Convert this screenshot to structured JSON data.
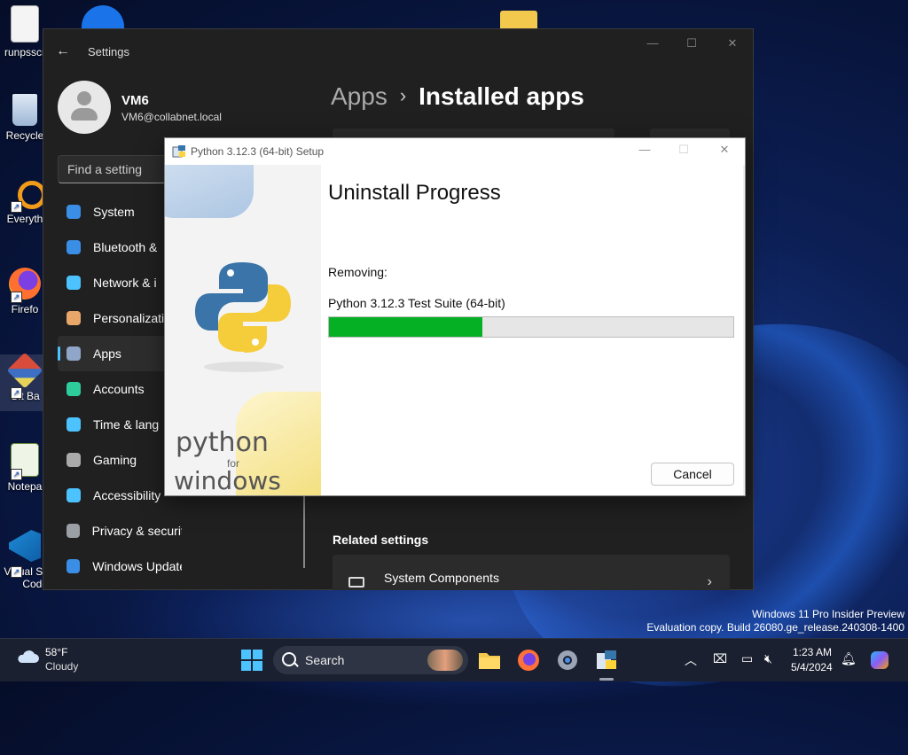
{
  "desktop": {
    "icons": [
      {
        "label": "runpsscr"
      },
      {
        "label": "Recycle"
      },
      {
        "label": "Everyth"
      },
      {
        "label": "Firefo"
      },
      {
        "label": "Git Ba"
      },
      {
        "label": "Notepa"
      },
      {
        "label": "Visual St"
      },
      {
        "label": "Code"
      }
    ],
    "watermark": {
      "line1": "Windows 11 Pro Insider Preview",
      "line2": "Evaluation copy. Build 26080.ge_release.240308-1400"
    }
  },
  "settings": {
    "title": "Settings",
    "profile": {
      "name": "VM6",
      "email": "VM6@collabnet.local"
    },
    "search_placeholder": "Find a setting",
    "nav": [
      {
        "label": "System",
        "icon": "monitor-icon",
        "color": "#3a8ee6"
      },
      {
        "label": "Bluetooth &",
        "icon": "bluetooth-icon",
        "color": "#3a8ee6"
      },
      {
        "label": "Network & i",
        "icon": "wifi-icon",
        "color": "#4cc2ff"
      },
      {
        "label": "Personalizati",
        "icon": "brush-icon",
        "color": "#e8a66a"
      },
      {
        "label": "Apps",
        "icon": "apps-icon",
        "color": "#8fa6c8",
        "active": true
      },
      {
        "label": "Accounts",
        "icon": "person-icon",
        "color": "#2ecc9a"
      },
      {
        "label": "Time & lang",
        "icon": "globe-clock-icon",
        "color": "#4cc2ff"
      },
      {
        "label": "Gaming",
        "icon": "gamepad-icon",
        "color": "#aaaaaa"
      },
      {
        "label": "Accessibility",
        "icon": "accessibility-icon",
        "color": "#4cc2ff"
      },
      {
        "label": "Privacy & security",
        "icon": "shield-icon",
        "color": "#9aa0a6"
      },
      {
        "label": "Windows Update",
        "icon": "update-icon",
        "color": "#3a8ee6"
      }
    ],
    "breadcrumb": {
      "parent": "Apps",
      "separator": "›",
      "current": "Installed apps"
    },
    "related_title": "Related settings",
    "related_item": {
      "label": "System Components",
      "chevron": "›"
    }
  },
  "python_dialog": {
    "title": "Python 3.12.3 (64-bit) Setup",
    "heading": "Uninstall Progress",
    "removing_label": "Removing:",
    "current_item": "Python 3.12.3 Test Suite (64-bit)",
    "progress_percent": 38,
    "cancel_label": "Cancel",
    "brand": {
      "word": "python",
      "for": "for",
      "windows": "windows"
    }
  },
  "taskbar": {
    "weather": {
      "temp": "58°F",
      "condition": "Cloudy"
    },
    "search_label": "Search",
    "clock": {
      "time": "1:23 AM",
      "date": "5/4/2024"
    }
  }
}
